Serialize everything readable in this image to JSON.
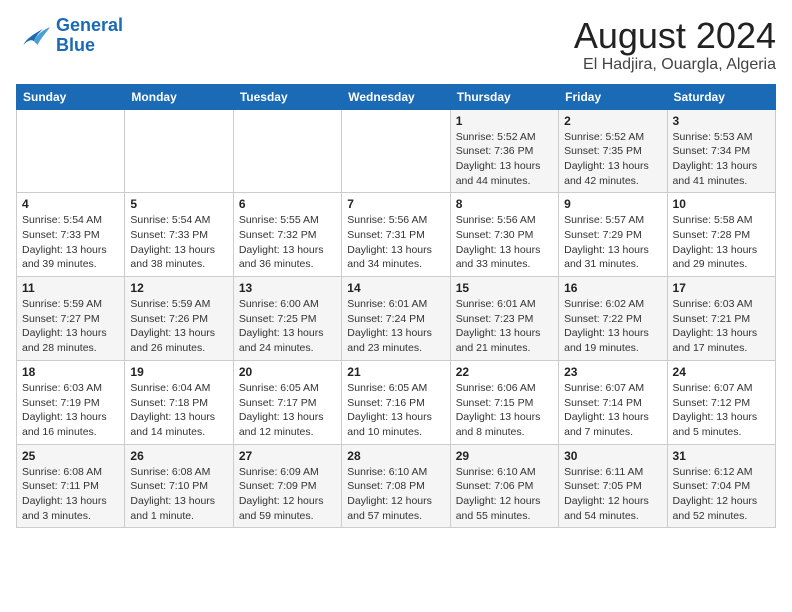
{
  "logo": {
    "line1": "General",
    "line2": "Blue"
  },
  "title": "August 2024",
  "subtitle": "El Hadjira, Ouargla, Algeria",
  "days_of_week": [
    "Sunday",
    "Monday",
    "Tuesday",
    "Wednesday",
    "Thursday",
    "Friday",
    "Saturday"
  ],
  "weeks": [
    [
      {
        "day": "",
        "info": ""
      },
      {
        "day": "",
        "info": ""
      },
      {
        "day": "",
        "info": ""
      },
      {
        "day": "",
        "info": ""
      },
      {
        "day": "1",
        "info": "Sunrise: 5:52 AM\nSunset: 7:36 PM\nDaylight: 13 hours\nand 44 minutes."
      },
      {
        "day": "2",
        "info": "Sunrise: 5:52 AM\nSunset: 7:35 PM\nDaylight: 13 hours\nand 42 minutes."
      },
      {
        "day": "3",
        "info": "Sunrise: 5:53 AM\nSunset: 7:34 PM\nDaylight: 13 hours\nand 41 minutes."
      }
    ],
    [
      {
        "day": "4",
        "info": "Sunrise: 5:54 AM\nSunset: 7:33 PM\nDaylight: 13 hours\nand 39 minutes."
      },
      {
        "day": "5",
        "info": "Sunrise: 5:54 AM\nSunset: 7:33 PM\nDaylight: 13 hours\nand 38 minutes."
      },
      {
        "day": "6",
        "info": "Sunrise: 5:55 AM\nSunset: 7:32 PM\nDaylight: 13 hours\nand 36 minutes."
      },
      {
        "day": "7",
        "info": "Sunrise: 5:56 AM\nSunset: 7:31 PM\nDaylight: 13 hours\nand 34 minutes."
      },
      {
        "day": "8",
        "info": "Sunrise: 5:56 AM\nSunset: 7:30 PM\nDaylight: 13 hours\nand 33 minutes."
      },
      {
        "day": "9",
        "info": "Sunrise: 5:57 AM\nSunset: 7:29 PM\nDaylight: 13 hours\nand 31 minutes."
      },
      {
        "day": "10",
        "info": "Sunrise: 5:58 AM\nSunset: 7:28 PM\nDaylight: 13 hours\nand 29 minutes."
      }
    ],
    [
      {
        "day": "11",
        "info": "Sunrise: 5:59 AM\nSunset: 7:27 PM\nDaylight: 13 hours\nand 28 minutes."
      },
      {
        "day": "12",
        "info": "Sunrise: 5:59 AM\nSunset: 7:26 PM\nDaylight: 13 hours\nand 26 minutes."
      },
      {
        "day": "13",
        "info": "Sunrise: 6:00 AM\nSunset: 7:25 PM\nDaylight: 13 hours\nand 24 minutes."
      },
      {
        "day": "14",
        "info": "Sunrise: 6:01 AM\nSunset: 7:24 PM\nDaylight: 13 hours\nand 23 minutes."
      },
      {
        "day": "15",
        "info": "Sunrise: 6:01 AM\nSunset: 7:23 PM\nDaylight: 13 hours\nand 21 minutes."
      },
      {
        "day": "16",
        "info": "Sunrise: 6:02 AM\nSunset: 7:22 PM\nDaylight: 13 hours\nand 19 minutes."
      },
      {
        "day": "17",
        "info": "Sunrise: 6:03 AM\nSunset: 7:21 PM\nDaylight: 13 hours\nand 17 minutes."
      }
    ],
    [
      {
        "day": "18",
        "info": "Sunrise: 6:03 AM\nSunset: 7:19 PM\nDaylight: 13 hours\nand 16 minutes."
      },
      {
        "day": "19",
        "info": "Sunrise: 6:04 AM\nSunset: 7:18 PM\nDaylight: 13 hours\nand 14 minutes."
      },
      {
        "day": "20",
        "info": "Sunrise: 6:05 AM\nSunset: 7:17 PM\nDaylight: 13 hours\nand 12 minutes."
      },
      {
        "day": "21",
        "info": "Sunrise: 6:05 AM\nSunset: 7:16 PM\nDaylight: 13 hours\nand 10 minutes."
      },
      {
        "day": "22",
        "info": "Sunrise: 6:06 AM\nSunset: 7:15 PM\nDaylight: 13 hours\nand 8 minutes."
      },
      {
        "day": "23",
        "info": "Sunrise: 6:07 AM\nSunset: 7:14 PM\nDaylight: 13 hours\nand 7 minutes."
      },
      {
        "day": "24",
        "info": "Sunrise: 6:07 AM\nSunset: 7:12 PM\nDaylight: 13 hours\nand 5 minutes."
      }
    ],
    [
      {
        "day": "25",
        "info": "Sunrise: 6:08 AM\nSunset: 7:11 PM\nDaylight: 13 hours\nand 3 minutes."
      },
      {
        "day": "26",
        "info": "Sunrise: 6:08 AM\nSunset: 7:10 PM\nDaylight: 13 hours\nand 1 minute."
      },
      {
        "day": "27",
        "info": "Sunrise: 6:09 AM\nSunset: 7:09 PM\nDaylight: 12 hours\nand 59 minutes."
      },
      {
        "day": "28",
        "info": "Sunrise: 6:10 AM\nSunset: 7:08 PM\nDaylight: 12 hours\nand 57 minutes."
      },
      {
        "day": "29",
        "info": "Sunrise: 6:10 AM\nSunset: 7:06 PM\nDaylight: 12 hours\nand 55 minutes."
      },
      {
        "day": "30",
        "info": "Sunrise: 6:11 AM\nSunset: 7:05 PM\nDaylight: 12 hours\nand 54 minutes."
      },
      {
        "day": "31",
        "info": "Sunrise: 6:12 AM\nSunset: 7:04 PM\nDaylight: 12 hours\nand 52 minutes."
      }
    ]
  ]
}
